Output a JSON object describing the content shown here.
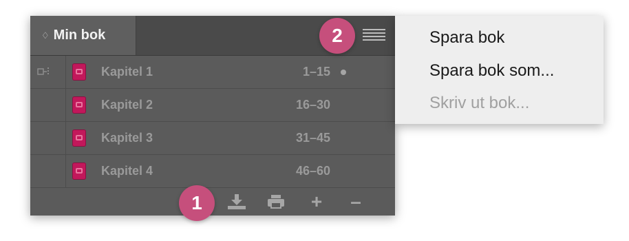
{
  "panel": {
    "tab": {
      "title": "Min bok",
      "sort_icon": "♢"
    },
    "menu_icon": "hamburger-menu-icon",
    "chapters": [
      {
        "name": "Kapitel 1",
        "pages": "1–15",
        "status": "dot"
      },
      {
        "name": "Kapitel 2",
        "pages": "16–30"
      },
      {
        "name": "Kapitel 3",
        "pages": "31–45"
      },
      {
        "name": "Kapitel 4",
        "pages": "46–60"
      }
    ],
    "toolbar": {
      "plus": "+",
      "minus": "–"
    }
  },
  "badges": {
    "one": "1",
    "two": "2"
  },
  "menu": {
    "items": [
      {
        "label": "Spara bok",
        "enabled": true
      },
      {
        "label": "Spara bok som...",
        "enabled": true
      },
      {
        "label": "Skriv ut bok...",
        "enabled": false
      }
    ]
  },
  "colors": {
    "badge": "#c64f7c",
    "document_icon": "#c2185b",
    "panel_bg": "#5b5b5b",
    "menu_bg": "#eeeeee"
  }
}
